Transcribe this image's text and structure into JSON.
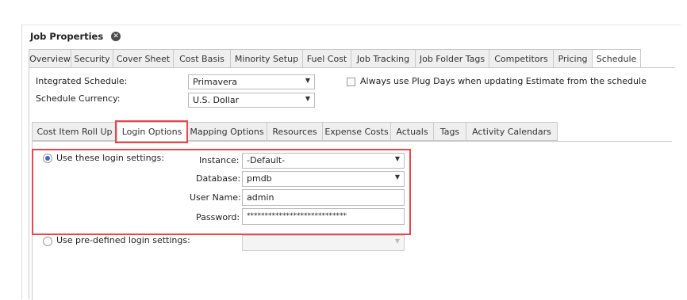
{
  "document_tab": {
    "title": "Job Properties",
    "close_icon": "close-icon"
  },
  "top_tabs": [
    "Overview",
    "Security",
    "Cover Sheet",
    "Cost Basis",
    "Minority Setup",
    "Fuel Cost",
    "Job Tracking",
    "Job Folder Tags",
    "Competitors",
    "Pricing",
    "Schedule"
  ],
  "top_tabs_active": "Schedule",
  "schedule": {
    "integrated_label": "Integrated Schedule:",
    "integrated_value": "Primavera",
    "currency_label": "Schedule Currency:",
    "currency_value": "U.S. Dollar",
    "plug_days_label": "Always use Plug Days when updating Estimate from the schedule"
  },
  "sub_tabs": [
    "Cost Item Roll Up",
    "Login Options",
    "Mapping Options",
    "Resources",
    "Expense Costs",
    "Actuals",
    "Tags",
    "Activity Calendars"
  ],
  "sub_tabs_active": "Login Options",
  "login": {
    "use_these_label": "Use these login settings:",
    "instance_label": "Instance:",
    "instance_value": "-Default-",
    "database_label": "Database:",
    "database_value": "pmdb",
    "username_label": "User Name:",
    "username_value": "admin",
    "password_label": "Password:",
    "password_value": "****************************",
    "predefined_label": "Use pre-defined login settings:",
    "predefined_value": ""
  },
  "colors": {
    "highlight": "#e8474f",
    "radio_selected": "#2d6fd6"
  }
}
